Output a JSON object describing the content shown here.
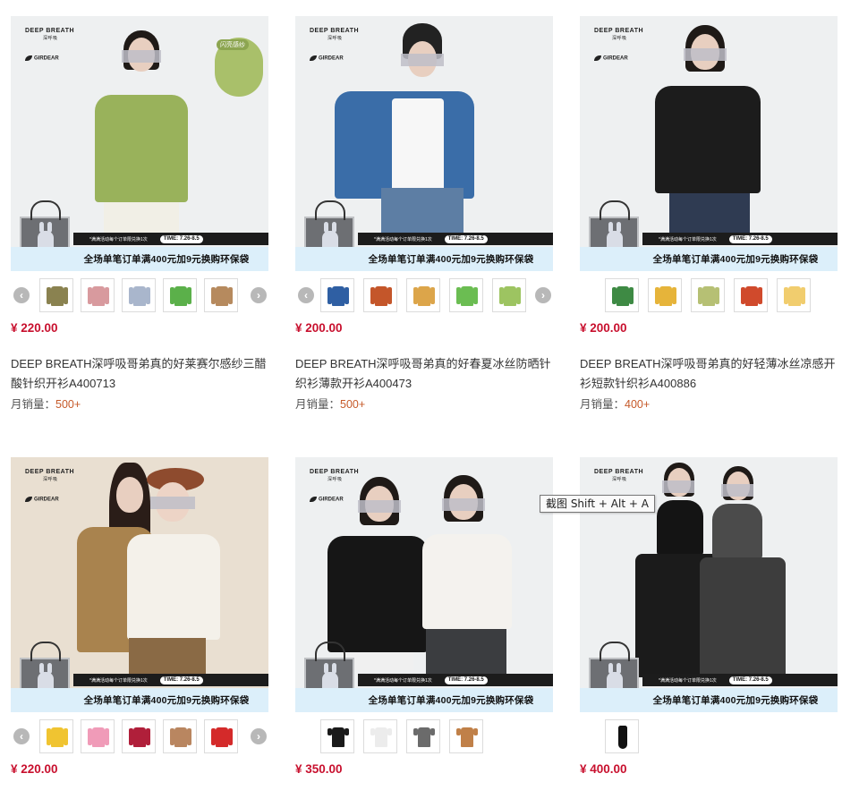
{
  "brand": {
    "name": "DEEP BREATH",
    "sub": "深呼吸",
    "partner": "GIRDEAR"
  },
  "promo": {
    "top_text": "*满满活动每个订单限兑换1次",
    "time": "TIME: 7.26-8.5",
    "bottom_text": "全场单笔订单满400元加9元换购环保袋"
  },
  "products": [
    {
      "price": "¥ 220.00",
      "title": "DEEP BREATH深呼吸哥弟真的好莱赛尔感纱三醋酸针织开衫A400713",
      "sales_label": "月销量：",
      "sales": "500+",
      "badge": "闪亮感纱",
      "swatches": [
        "#8a8250",
        "#d89a9e",
        "#a9b6cc",
        "#5bb04a",
        "#b68a5e"
      ]
    },
    {
      "price": "¥ 200.00",
      "title": "DEEP BREATH深呼吸哥弟真的好春夏冰丝防晒针织衫薄款开衫A400473",
      "sales_label": "月销量：",
      "sales": "500+",
      "swatches": [
        "#2f5fa3",
        "#c4562a",
        "#dca54a",
        "#6bbd52",
        "#9dc461"
      ]
    },
    {
      "price": "¥ 200.00",
      "title": "DEEP BREATH深呼吸哥弟真的好轻薄冰丝凉感开衫短款针织衫A400886",
      "sales_label": "月销量：",
      "sales": "400+",
      "swatches": [
        "#3e8a44",
        "#e6b43a",
        "#b6c074",
        "#d04a2c",
        "#f1cd6e"
      ]
    },
    {
      "price": "¥ 220.00",
      "swatches": [
        "#f0c431",
        "#f09bb8",
        "#b01f3a",
        "#b98660",
        "#d42a2a"
      ]
    },
    {
      "price": "¥ 350.00",
      "swatches": [
        "#1a1a1a",
        "#ececec",
        "#6b6b6b",
        "#c08048"
      ]
    },
    {
      "price": "¥ 400.00",
      "swatches": [
        "#111111"
      ]
    }
  ],
  "tooltip": {
    "text": "截图 Shift + Alt + A"
  }
}
